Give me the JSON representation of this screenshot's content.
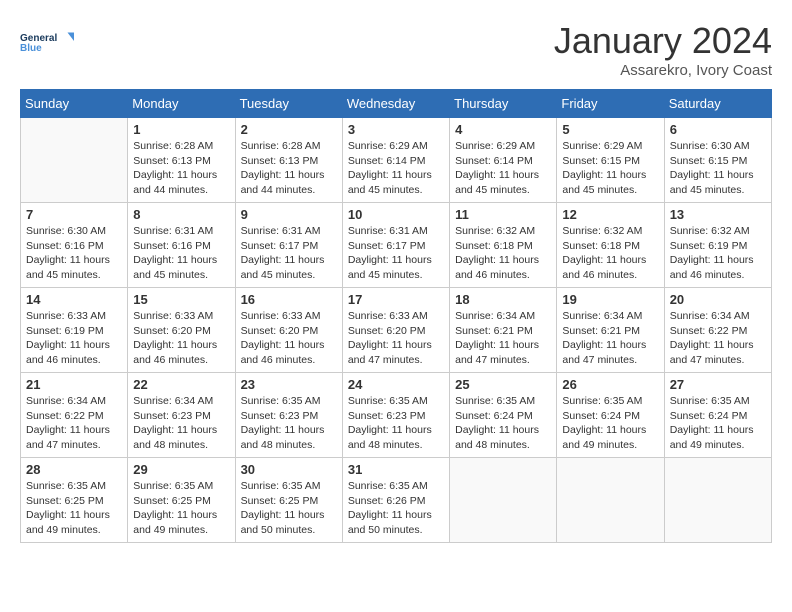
{
  "header": {
    "logo_line1": "General",
    "logo_line2": "Blue",
    "title": "January 2024",
    "subtitle": "Assarekro, Ivory Coast"
  },
  "calendar": {
    "headers": [
      "Sunday",
      "Monday",
      "Tuesday",
      "Wednesday",
      "Thursday",
      "Friday",
      "Saturday"
    ],
    "weeks": [
      [
        {
          "day": "",
          "sunrise": "",
          "sunset": "",
          "daylight": ""
        },
        {
          "day": "1",
          "sunrise": "Sunrise: 6:28 AM",
          "sunset": "Sunset: 6:13 PM",
          "daylight": "Daylight: 11 hours and 44 minutes."
        },
        {
          "day": "2",
          "sunrise": "Sunrise: 6:28 AM",
          "sunset": "Sunset: 6:13 PM",
          "daylight": "Daylight: 11 hours and 44 minutes."
        },
        {
          "day": "3",
          "sunrise": "Sunrise: 6:29 AM",
          "sunset": "Sunset: 6:14 PM",
          "daylight": "Daylight: 11 hours and 45 minutes."
        },
        {
          "day": "4",
          "sunrise": "Sunrise: 6:29 AM",
          "sunset": "Sunset: 6:14 PM",
          "daylight": "Daylight: 11 hours and 45 minutes."
        },
        {
          "day": "5",
          "sunrise": "Sunrise: 6:29 AM",
          "sunset": "Sunset: 6:15 PM",
          "daylight": "Daylight: 11 hours and 45 minutes."
        },
        {
          "day": "6",
          "sunrise": "Sunrise: 6:30 AM",
          "sunset": "Sunset: 6:15 PM",
          "daylight": "Daylight: 11 hours and 45 minutes."
        }
      ],
      [
        {
          "day": "7",
          "sunrise": "Sunrise: 6:30 AM",
          "sunset": "Sunset: 6:16 PM",
          "daylight": "Daylight: 11 hours and 45 minutes."
        },
        {
          "day": "8",
          "sunrise": "Sunrise: 6:31 AM",
          "sunset": "Sunset: 6:16 PM",
          "daylight": "Daylight: 11 hours and 45 minutes."
        },
        {
          "day": "9",
          "sunrise": "Sunrise: 6:31 AM",
          "sunset": "Sunset: 6:17 PM",
          "daylight": "Daylight: 11 hours and 45 minutes."
        },
        {
          "day": "10",
          "sunrise": "Sunrise: 6:31 AM",
          "sunset": "Sunset: 6:17 PM",
          "daylight": "Daylight: 11 hours and 45 minutes."
        },
        {
          "day": "11",
          "sunrise": "Sunrise: 6:32 AM",
          "sunset": "Sunset: 6:18 PM",
          "daylight": "Daylight: 11 hours and 46 minutes."
        },
        {
          "day": "12",
          "sunrise": "Sunrise: 6:32 AM",
          "sunset": "Sunset: 6:18 PM",
          "daylight": "Daylight: 11 hours and 46 minutes."
        },
        {
          "day": "13",
          "sunrise": "Sunrise: 6:32 AM",
          "sunset": "Sunset: 6:19 PM",
          "daylight": "Daylight: 11 hours and 46 minutes."
        }
      ],
      [
        {
          "day": "14",
          "sunrise": "Sunrise: 6:33 AM",
          "sunset": "Sunset: 6:19 PM",
          "daylight": "Daylight: 11 hours and 46 minutes."
        },
        {
          "day": "15",
          "sunrise": "Sunrise: 6:33 AM",
          "sunset": "Sunset: 6:20 PM",
          "daylight": "Daylight: 11 hours and 46 minutes."
        },
        {
          "day": "16",
          "sunrise": "Sunrise: 6:33 AM",
          "sunset": "Sunset: 6:20 PM",
          "daylight": "Daylight: 11 hours and 46 minutes."
        },
        {
          "day": "17",
          "sunrise": "Sunrise: 6:33 AM",
          "sunset": "Sunset: 6:20 PM",
          "daylight": "Daylight: 11 hours and 47 minutes."
        },
        {
          "day": "18",
          "sunrise": "Sunrise: 6:34 AM",
          "sunset": "Sunset: 6:21 PM",
          "daylight": "Daylight: 11 hours and 47 minutes."
        },
        {
          "day": "19",
          "sunrise": "Sunrise: 6:34 AM",
          "sunset": "Sunset: 6:21 PM",
          "daylight": "Daylight: 11 hours and 47 minutes."
        },
        {
          "day": "20",
          "sunrise": "Sunrise: 6:34 AM",
          "sunset": "Sunset: 6:22 PM",
          "daylight": "Daylight: 11 hours and 47 minutes."
        }
      ],
      [
        {
          "day": "21",
          "sunrise": "Sunrise: 6:34 AM",
          "sunset": "Sunset: 6:22 PM",
          "daylight": "Daylight: 11 hours and 47 minutes."
        },
        {
          "day": "22",
          "sunrise": "Sunrise: 6:34 AM",
          "sunset": "Sunset: 6:23 PM",
          "daylight": "Daylight: 11 hours and 48 minutes."
        },
        {
          "day": "23",
          "sunrise": "Sunrise: 6:35 AM",
          "sunset": "Sunset: 6:23 PM",
          "daylight": "Daylight: 11 hours and 48 minutes."
        },
        {
          "day": "24",
          "sunrise": "Sunrise: 6:35 AM",
          "sunset": "Sunset: 6:23 PM",
          "daylight": "Daylight: 11 hours and 48 minutes."
        },
        {
          "day": "25",
          "sunrise": "Sunrise: 6:35 AM",
          "sunset": "Sunset: 6:24 PM",
          "daylight": "Daylight: 11 hours and 48 minutes."
        },
        {
          "day": "26",
          "sunrise": "Sunrise: 6:35 AM",
          "sunset": "Sunset: 6:24 PM",
          "daylight": "Daylight: 11 hours and 49 minutes."
        },
        {
          "day": "27",
          "sunrise": "Sunrise: 6:35 AM",
          "sunset": "Sunset: 6:24 PM",
          "daylight": "Daylight: 11 hours and 49 minutes."
        }
      ],
      [
        {
          "day": "28",
          "sunrise": "Sunrise: 6:35 AM",
          "sunset": "Sunset: 6:25 PM",
          "daylight": "Daylight: 11 hours and 49 minutes."
        },
        {
          "day": "29",
          "sunrise": "Sunrise: 6:35 AM",
          "sunset": "Sunset: 6:25 PM",
          "daylight": "Daylight: 11 hours and 49 minutes."
        },
        {
          "day": "30",
          "sunrise": "Sunrise: 6:35 AM",
          "sunset": "Sunset: 6:25 PM",
          "daylight": "Daylight: 11 hours and 50 minutes."
        },
        {
          "day": "31",
          "sunrise": "Sunrise: 6:35 AM",
          "sunset": "Sunset: 6:26 PM",
          "daylight": "Daylight: 11 hours and 50 minutes."
        },
        {
          "day": "",
          "sunrise": "",
          "sunset": "",
          "daylight": ""
        },
        {
          "day": "",
          "sunrise": "",
          "sunset": "",
          "daylight": ""
        },
        {
          "day": "",
          "sunrise": "",
          "sunset": "",
          "daylight": ""
        }
      ]
    ]
  }
}
